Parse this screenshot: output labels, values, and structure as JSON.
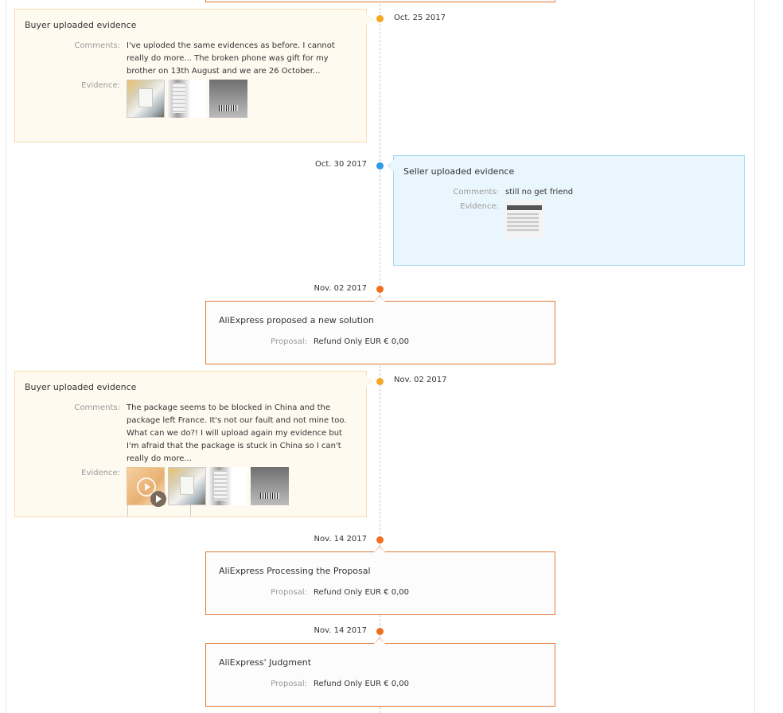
{
  "colors": {
    "buyer_bg": "#fffaf0",
    "buyer_border": "#f9ddb0",
    "seller_bg": "#eaf6fd",
    "seller_border": "#a8d7f2",
    "system_border": "#e07a35",
    "dot_buyer": "#f5a623",
    "dot_seller": "#2d9be8",
    "dot_system": "#f06f1e"
  },
  "events": [
    {
      "type": "buyer",
      "date": "Oct. 25 2017",
      "title": "Buyer uploaded evidence",
      "comments_label": "Comments:",
      "comments": "I've uploded the same evidences as before. I cannot really do more... The broken phone was gift for my brother on 13th August and we are 26 October...",
      "evidence_label": "Evidence:",
      "evidence": [
        "box-photo-thumbnail",
        "receipt-photo-thumbnail",
        "barcode-photo-thumbnail"
      ]
    },
    {
      "type": "seller",
      "date": "Oct. 30 2017",
      "title": "Seller uploaded evidence",
      "comments_label": "Comments:",
      "comments": "still no get friend",
      "evidence_label": "Evidence:",
      "evidence": [
        "screenshot-thumbnail"
      ]
    },
    {
      "type": "system",
      "date": "Nov. 02 2017",
      "title": "AliExpress proposed a new solution",
      "proposal_label": "Proposal:",
      "proposal": "Refund Only EUR € 0,00"
    },
    {
      "type": "buyer",
      "date": "Nov. 02 2017",
      "title": "Buyer uploaded evidence",
      "comments_label": "Comments:",
      "comments": "The package seems to be blocked in China and the package left France. It's not our fault and not mine too. What can we do?! I will upload again my evidence but I'm afraid that the package is stuck in China so I can't really do more...",
      "evidence_label": "Evidence:",
      "evidence": [
        "video-thumbnail",
        "box-photo-thumbnail",
        "receipt-photo-thumbnail",
        "barcode-photo-thumbnail"
      ]
    },
    {
      "type": "system",
      "date": "Nov. 14 2017",
      "title": "AliExpress Processing the Proposal",
      "proposal_label": "Proposal:",
      "proposal": "Refund Only EUR € 0,00"
    },
    {
      "type": "system",
      "date": "Nov. 14 2017",
      "title": "AliExpress' Judgment",
      "proposal_label": "Proposal:",
      "proposal": "Refund Only EUR € 0,00"
    }
  ]
}
